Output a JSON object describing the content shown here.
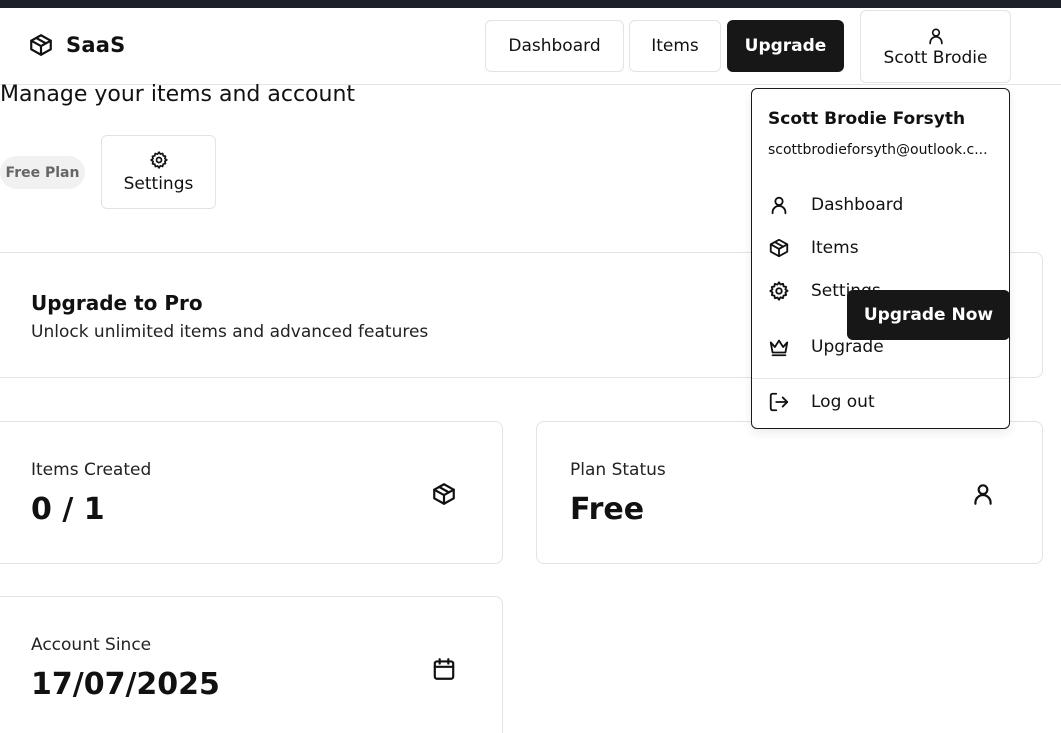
{
  "app": {
    "brand_name": "SaaS",
    "brand_icon": "package-icon"
  },
  "nav": {
    "dashboard_label": "Dashboard",
    "items_label": "Items",
    "upgrade_label": "Upgrade",
    "user_label": "Scott Brodie",
    "user_icon": "user-icon"
  },
  "page": {
    "subtitle": "Manage your items and account",
    "plan_badge": "Free Plan",
    "settings_label": "Settings"
  },
  "upgrade_card": {
    "title": "Upgrade to Pro",
    "description": "Unlock unlimited items and advanced features",
    "button_label": "Upgrade Now"
  },
  "stats": [
    {
      "label": "Items Created",
      "value": "0 / 1",
      "icon": "package-icon"
    },
    {
      "label": "Plan Status",
      "value": "Free",
      "icon": "user-icon"
    },
    {
      "label": "Account Since",
      "value": "17/07/2025",
      "icon": "calendar-icon"
    }
  ],
  "user_menu": {
    "name": "Scott Brodie Forsyth",
    "email": "scottbrodieforsyth@outlook.c...",
    "items": [
      {
        "label": "Dashboard",
        "icon": "user-icon"
      },
      {
        "label": "Items",
        "icon": "package-icon"
      },
      {
        "label": "Settings",
        "icon": "gear-icon"
      },
      {
        "label": "Upgrade",
        "icon": "crown-icon"
      },
      {
        "label": "Log out",
        "icon": "logout-icon"
      }
    ]
  },
  "colors": {
    "primary": "#171717",
    "badge_bg": "#f1f1f1",
    "border": "#e3e3e3",
    "topbar": "#1e2029"
  }
}
